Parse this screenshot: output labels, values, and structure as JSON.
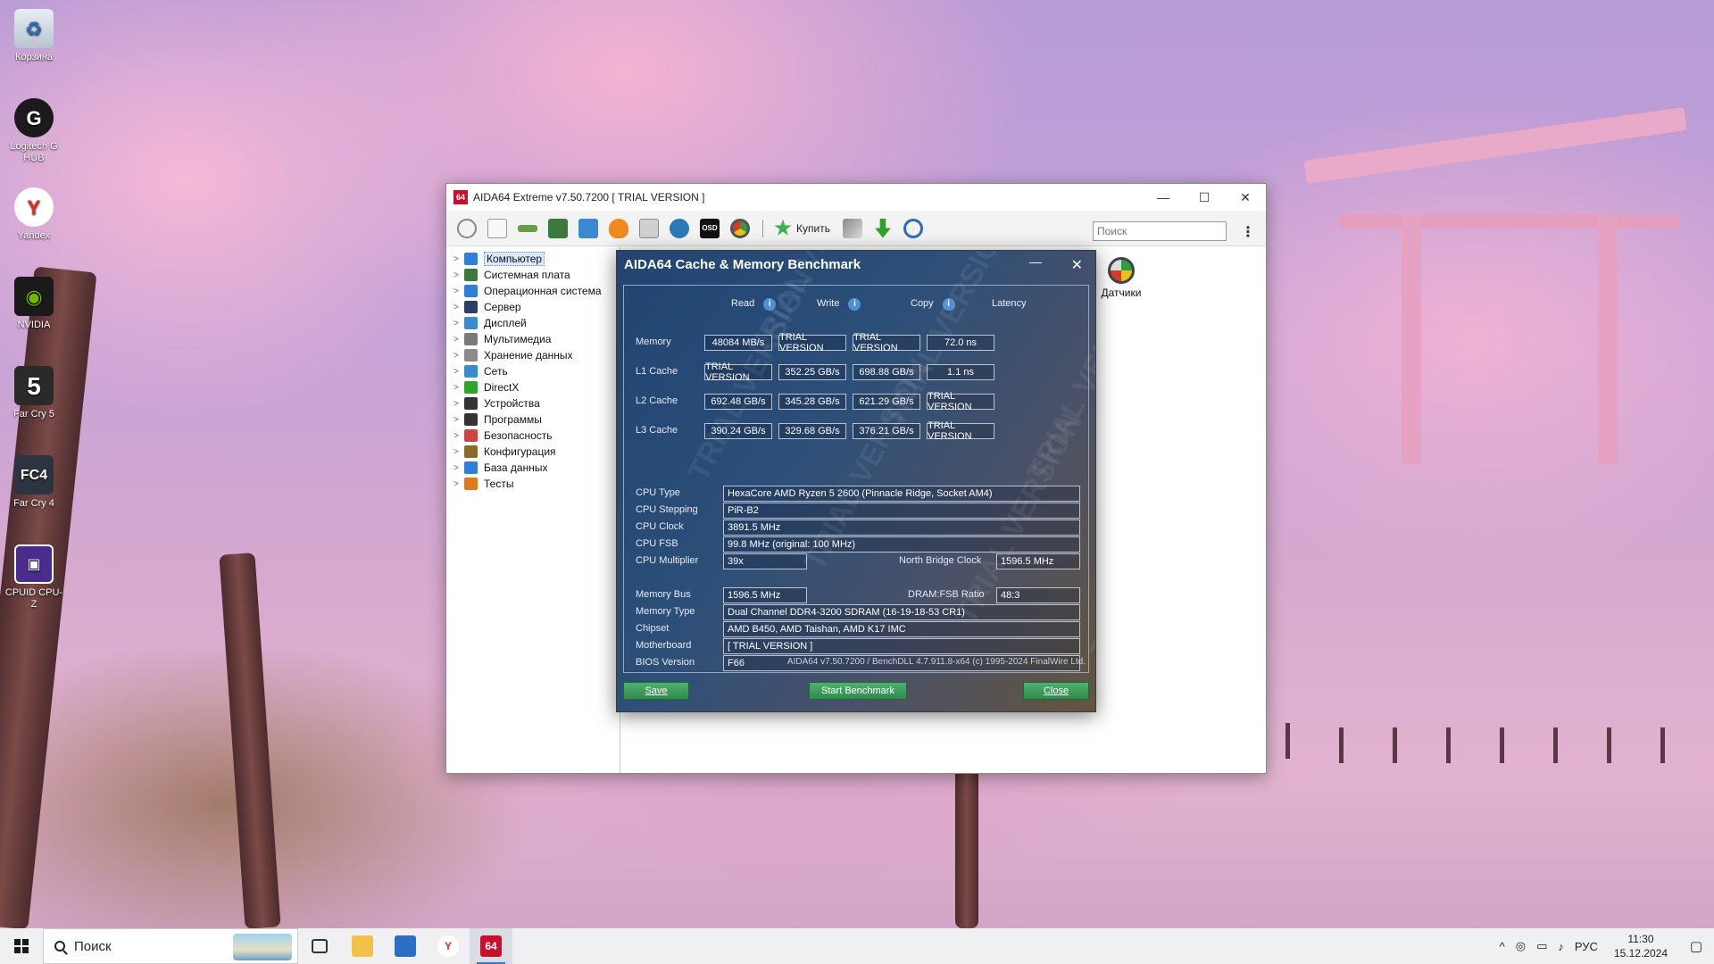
{
  "desktop_icons": [
    {
      "label": "Корзина"
    },
    {
      "label": "Logitech G HUB"
    },
    {
      "label": "Yandex"
    },
    {
      "label": "NVIDIA"
    },
    {
      "label": "Far Cry 5"
    },
    {
      "label": "Far Cry 4"
    },
    {
      "label": "CPUID CPU-Z"
    }
  ],
  "aida": {
    "title": "AIDA64 Extreme v7.50.7200 [ TRIAL VERSION ]",
    "buy_label": "Купить",
    "search_placeholder": "Поиск",
    "sensors_label": "Датчики",
    "tree": [
      "Компьютер",
      "Системная плата",
      "Операционная система",
      "Сервер",
      "Дисплей",
      "Мультимедиа",
      "Хранение данных",
      "Сеть",
      "DirectX",
      "Устройства",
      "Программы",
      "Безопасность",
      "Конфигурация",
      "База данных",
      "Тесты"
    ]
  },
  "bench": {
    "title": "AIDA64 Cache & Memory Benchmark",
    "headers": {
      "read": "Read",
      "write": "Write",
      "copy": "Copy",
      "latency": "Latency"
    },
    "rows": [
      {
        "label": "Memory",
        "read": "48084 MB/s",
        "write": "TRIAL VERSION",
        "copy": "TRIAL VERSION",
        "latency": "72.0 ns"
      },
      {
        "label": "L1 Cache",
        "read": "TRIAL VERSION",
        "write": "352.25 GB/s",
        "copy": "698.88 GB/s",
        "latency": "1.1 ns"
      },
      {
        "label": "L2 Cache",
        "read": "692.48 GB/s",
        "write": "345.28 GB/s",
        "copy": "621.29 GB/s",
        "latency": "TRIAL VERSION"
      },
      {
        "label": "L3 Cache",
        "read": "390.24 GB/s",
        "write": "329.68 GB/s",
        "copy": "376.21 GB/s",
        "latency": "TRIAL VERSION"
      }
    ],
    "info": {
      "cpu_type_label": "CPU Type",
      "cpu_type": "HexaCore AMD Ryzen 5 2600 (Pinnacle Ridge, Socket AM4)",
      "cpu_stepping_label": "CPU Stepping",
      "cpu_stepping": "PiR-B2",
      "cpu_clock_label": "CPU Clock",
      "cpu_clock": "3891.5 MHz",
      "cpu_fsb_label": "CPU FSB",
      "cpu_fsb": "99.8 MHz (original: 100 MHz)",
      "cpu_multiplier_label": "CPU Multiplier",
      "cpu_multiplier": "39x",
      "nb_clock_label": "North Bridge Clock",
      "nb_clock": "1596.5 MHz",
      "memory_bus_label": "Memory Bus",
      "memory_bus": "1596.5 MHz",
      "dram_ratio_label": "DRAM:FSB Ratio",
      "dram_ratio": "48:3",
      "memory_type_label": "Memory Type",
      "memory_type": "Dual Channel DDR4-3200 SDRAM (16-19-18-53 CR1)",
      "chipset_label": "Chipset",
      "chipset": "AMD B450, AMD Taishan, AMD K17 IMC",
      "motherboard_label": "Motherboard",
      "motherboard": "[ TRIAL VERSION ]",
      "bios_label": "BIOS Version",
      "bios": "F66"
    },
    "footer": "AIDA64 v7.50.7200 / BenchDLL 4.7.911.8-x64 (c) 1995-2024 FinalWire Ltd.",
    "watermark": "TRIAL VERSION",
    "buttons": {
      "save": "Save",
      "start": "Start Benchmark",
      "close": "Close"
    }
  },
  "taskbar": {
    "search": "Поиск",
    "lang": "РУС",
    "time": "11:30",
    "date": "15.12.2024"
  }
}
